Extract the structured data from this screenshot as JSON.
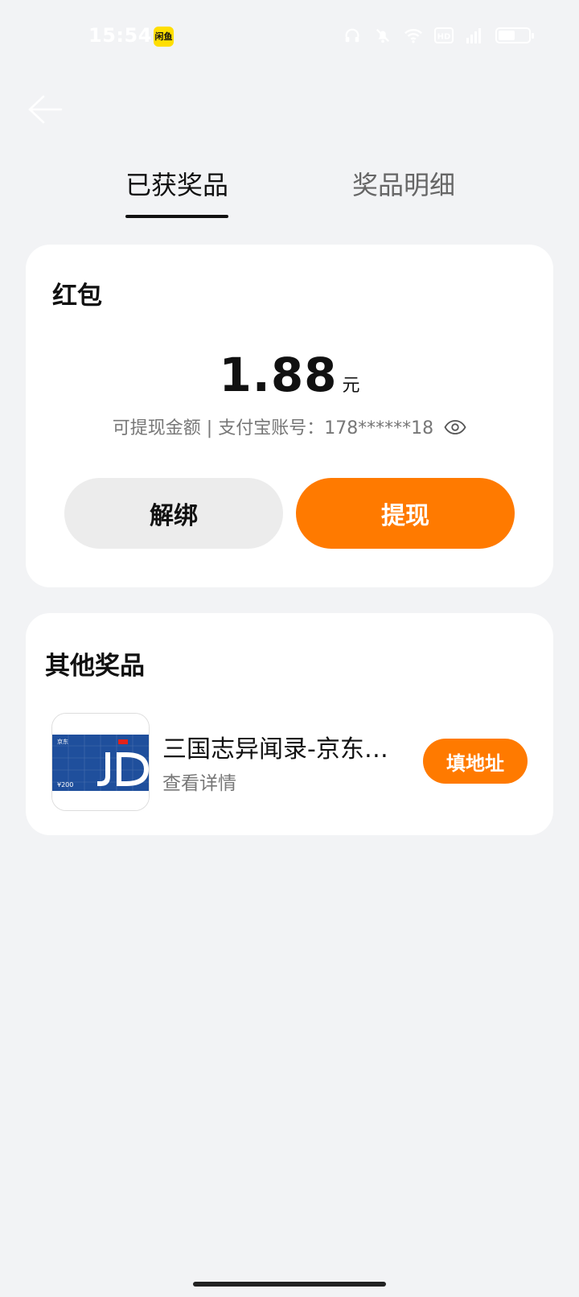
{
  "status_bar": {
    "time": "15:54",
    "app_badge": "闲鱼",
    "icons": [
      "headphones-icon",
      "bell-muted-icon",
      "wifi-icon",
      "hd-icon",
      "signal-icon",
      "battery-icon"
    ],
    "battery_level": 0.55
  },
  "tabs": [
    {
      "label": "已获奖品",
      "active": true
    },
    {
      "label": "奖品明细",
      "active": false
    }
  ],
  "red_packet": {
    "title": "红包",
    "amount": "1.88",
    "unit": "元",
    "subtext": "可提现金额 | 支付宝账号：178******18",
    "unbind_label": "解绑",
    "withdraw_label": "提现"
  },
  "other_prizes": {
    "title": "其他奖品",
    "items": [
      {
        "name": "三国志异闻录-京东…",
        "detail": "查看详情",
        "action_label": "填地址",
        "card_value": "¥200",
        "card_brand": "京东"
      }
    ]
  },
  "colors": {
    "accent": "#ff7a00",
    "background": "#f2f3f5",
    "card": "#ffffff",
    "jd_blue": "#1f4f9c"
  }
}
